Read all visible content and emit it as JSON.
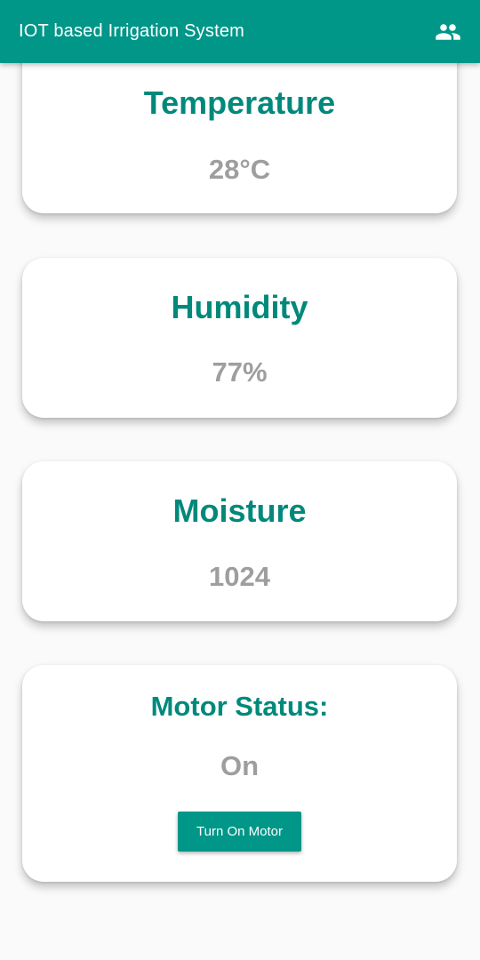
{
  "app_bar": {
    "title": "IOT based Irrigation System",
    "action_icon": "people-icon",
    "background": "#009688"
  },
  "cards": {
    "temperature": {
      "label": "Temperature",
      "value": "28°C"
    },
    "humidity": {
      "label": "Humidity",
      "value": "77%"
    },
    "moisture": {
      "label": "Moisture",
      "value": "1024"
    },
    "motor": {
      "label": "Motor Status:",
      "value": "On",
      "button_label": "Turn On Motor"
    }
  },
  "colors": {
    "accent": "#009688",
    "title_text": "#00897b",
    "value_text": "#9e9e9e",
    "page_background": "#fafafa"
  }
}
